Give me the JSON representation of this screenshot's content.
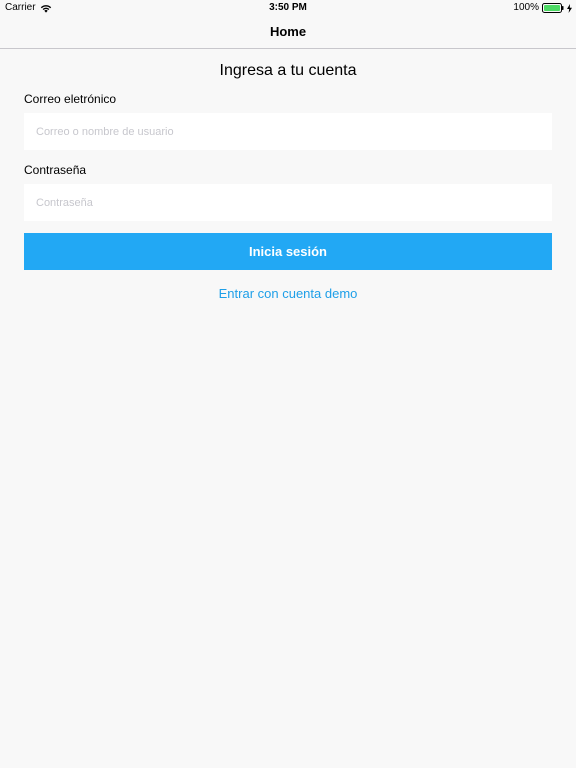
{
  "status_bar": {
    "carrier": "Carrier",
    "time": "3:50 PM",
    "battery": "100%",
    "wifi_icon": "wifi-icon",
    "battery_icon": "battery-icon",
    "battery_color": "#4cd964",
    "charging_icon": "charging-bolt-icon"
  },
  "nav": {
    "title": "Home"
  },
  "login": {
    "heading": "Ingresa a tu cuenta",
    "email_label": "Correo eletrónico",
    "email_placeholder": "Correo o nombre de usuario",
    "email_value": "",
    "password_label": "Contraseña",
    "password_placeholder": "Contraseña",
    "password_value": "",
    "submit_label": "Inicia sesión",
    "demo_link_label": "Entrar con cuenta demo"
  },
  "colors": {
    "accent": "#22a8f4",
    "link": "#1e9fe8",
    "background": "#f8f8f8"
  }
}
